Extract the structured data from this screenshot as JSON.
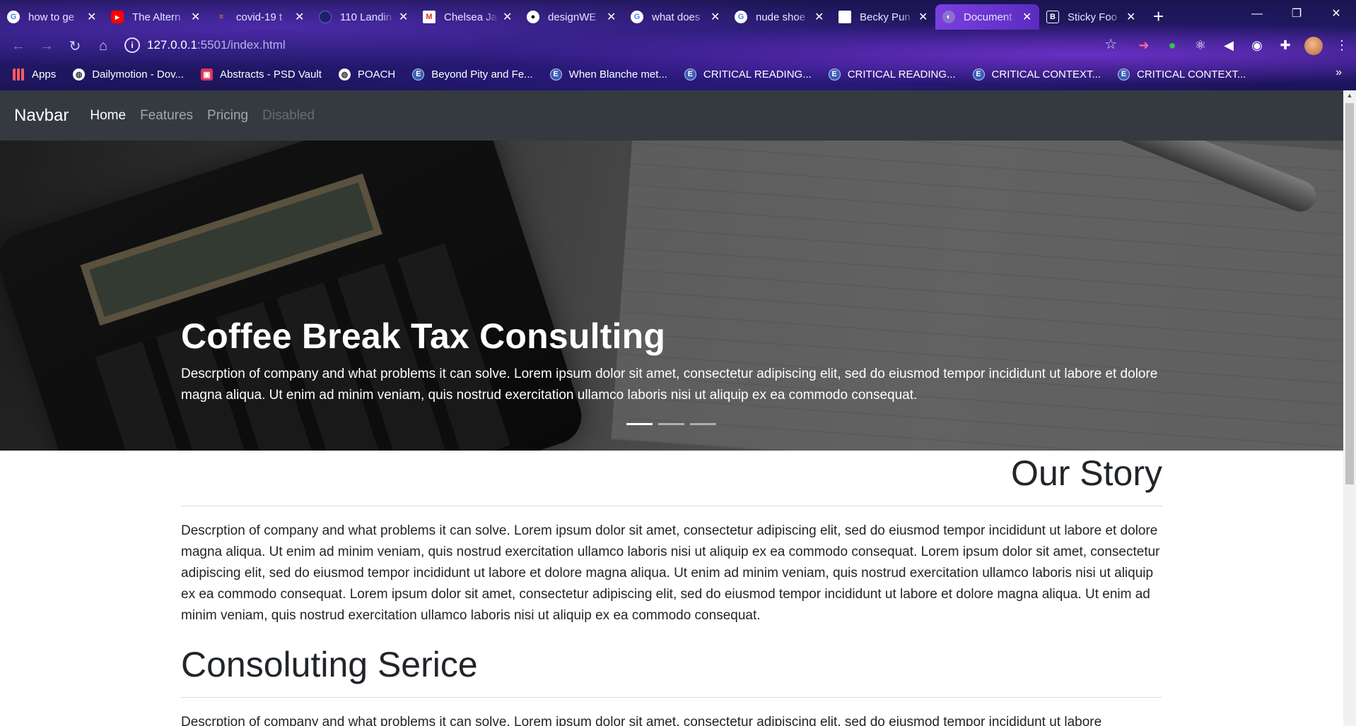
{
  "browser": {
    "tabs": [
      {
        "title": "how to ge",
        "icon": "google-icon"
      },
      {
        "title": "The Altern",
        "icon": "youtube-icon"
      },
      {
        "title": "covid-19 t",
        "icon": "stackoverflow-icon"
      },
      {
        "title": "110 Landin",
        "icon": "site-icon"
      },
      {
        "title": "Chelsea Ja",
        "icon": "gmail-icon"
      },
      {
        "title": "designWE",
        "icon": "github-icon"
      },
      {
        "title": "what does",
        "icon": "google-icon"
      },
      {
        "title": "nude shoe",
        "icon": "google-icon"
      },
      {
        "title": "Becky Pun",
        "icon": "page-icon"
      },
      {
        "title": "Document",
        "icon": "globe-icon",
        "active": true
      },
      {
        "title": "Sticky Foo",
        "icon": "bootstrap-icon"
      }
    ],
    "url_host": "127.0.0.1",
    "url_path": ":5501/index.html",
    "bookmarks": [
      {
        "label": "Apps",
        "icon": "apps-grid-icon"
      },
      {
        "label": "Dailymotion - Dov...",
        "icon": "globe-icon"
      },
      {
        "label": "Abstracts - PSD Vault",
        "icon": "psd-icon"
      },
      {
        "label": "POACH",
        "icon": "globe-icon"
      },
      {
        "label": "Beyond Pity and Fe...",
        "icon": "e-icon"
      },
      {
        "label": "When Blanche met...",
        "icon": "e-icon"
      },
      {
        "label": "CRITICAL READING...",
        "icon": "e-icon"
      },
      {
        "label": "CRITICAL READING...",
        "icon": "e-icon"
      },
      {
        "label": "CRITICAL CONTEXT...",
        "icon": "e-icon"
      },
      {
        "label": "CRITICAL CONTEXT...",
        "icon": "e-icon"
      }
    ],
    "bookmarks_more": "»"
  },
  "page": {
    "navbar": {
      "brand": "Navbar",
      "links": [
        {
          "label": "Home",
          "state": "active"
        },
        {
          "label": "Features",
          "state": "normal"
        },
        {
          "label": "Pricing",
          "state": "normal"
        },
        {
          "label": "Disabled",
          "state": "disabled"
        }
      ]
    },
    "hero": {
      "title": "Coffee Break Tax Consulting",
      "description": "Descrption of company and what problems it can solve. Lorem ipsum dolor sit amet, consectetur adipiscing elit, sed do eiusmod tempor incididunt ut labore et dolore magna aliqua. Ut enim ad minim veniam, quis nostrud exercitation ullamco laboris nisi ut aliquip ex ea commodo consequat.",
      "slides": 3,
      "active_slide": 1
    },
    "story": {
      "heading": "Our Story",
      "body": "Descrption of company and what problems it can solve. Lorem ipsum dolor sit amet, consectetur adipiscing elit, sed do eiusmod tempor incididunt ut labore et dolore magna aliqua. Ut enim ad minim veniam, quis nostrud exercitation ullamco laboris nisi ut aliquip ex ea commodo consequat. Lorem ipsum dolor sit amet, consectetur adipiscing elit, sed do eiusmod tempor incididunt ut labore et dolore magna aliqua. Ut enim ad minim veniam, quis nostrud exercitation ullamco laboris nisi ut aliquip ex ea commodo consequat. Lorem ipsum dolor sit amet, consectetur adipiscing elit, sed do eiusmod tempor incididunt ut labore et dolore magna aliqua. Ut enim ad minim veniam, quis nostrud exercitation ullamco laboris nisi ut aliquip ex ea commodo consequat."
    },
    "service": {
      "heading": "Consoluting Serice",
      "body": "Descrption of company and what problems it can solve. Lorem ipsum dolor sit amet, consectetur adipiscing elit, sed do eiusmod tempor incididunt ut labore"
    }
  },
  "colors": {
    "navbar_bg": "#343a40",
    "text": "#212529",
    "active_tab": "#7b3fe0"
  }
}
